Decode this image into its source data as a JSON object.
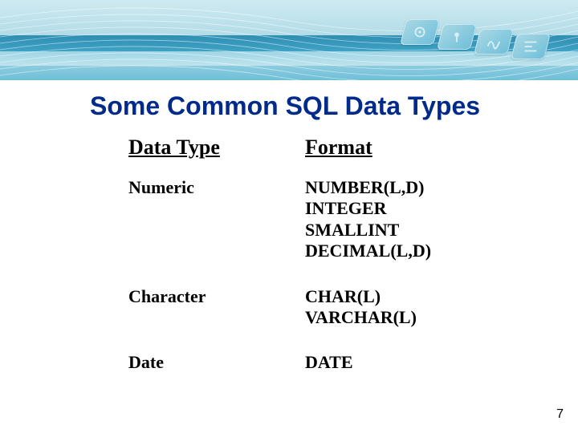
{
  "title": "Some Common SQL Data Types",
  "columns": {
    "a": "Data Type",
    "b": "Format"
  },
  "rows": [
    {
      "category": "Numeric",
      "formats": [
        "NUMBER(L,D)",
        "INTEGER",
        "SMALLINT",
        "DECIMAL(L,D)"
      ]
    },
    {
      "category": "Character",
      "formats": [
        "CHAR(L)",
        "VARCHAR(L)"
      ]
    },
    {
      "category": "Date",
      "formats": [
        "DATE"
      ]
    }
  ],
  "page_number": "7"
}
